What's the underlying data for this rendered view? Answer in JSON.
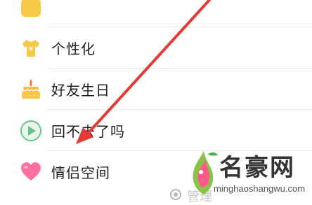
{
  "menu": {
    "items": [
      {
        "label": "",
        "icon": "yellow-partial-icon"
      },
      {
        "label": "个性化",
        "icon": "shirt-icon"
      },
      {
        "label": "好友生日",
        "icon": "cake-icon"
      },
      {
        "label": "回不去了吗",
        "icon": "play-icon"
      },
      {
        "label": "情侣空间",
        "icon": "heart-icon"
      }
    ]
  },
  "bottom_hint": {
    "label": "管理",
    "icon": "manage-icon"
  },
  "watermark": {
    "name": "名豪网",
    "url": "minghaoshangwu.com"
  },
  "annotation": {
    "arrow_color": "#e53935"
  },
  "colors": {
    "accent_yellow": "#f7c948",
    "heart_pink": "#ff6fa0",
    "play_green": "#6cc48a"
  }
}
